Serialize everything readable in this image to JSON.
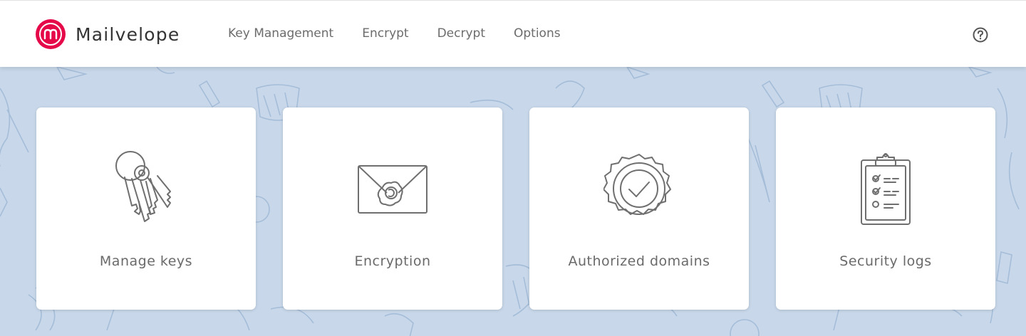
{
  "brand": {
    "name": "Mailvelope",
    "color": "#e6094a"
  },
  "nav": {
    "items": [
      {
        "label": "Key Management"
      },
      {
        "label": "Encrypt"
      },
      {
        "label": "Decrypt"
      },
      {
        "label": "Options"
      }
    ],
    "help_icon": "question-circle-icon"
  },
  "cards": [
    {
      "label": "Manage keys",
      "icon": "keys-icon"
    },
    {
      "label": "Encryption",
      "icon": "sealed-envelope-icon"
    },
    {
      "label": "Authorized domains",
      "icon": "certified-badge-icon"
    },
    {
      "label": "Security logs",
      "icon": "clipboard-checklist-icon"
    }
  ],
  "colors": {
    "background": "#c8d8ea",
    "pattern": "#9fb8d4",
    "text": "#6a6a6a"
  }
}
